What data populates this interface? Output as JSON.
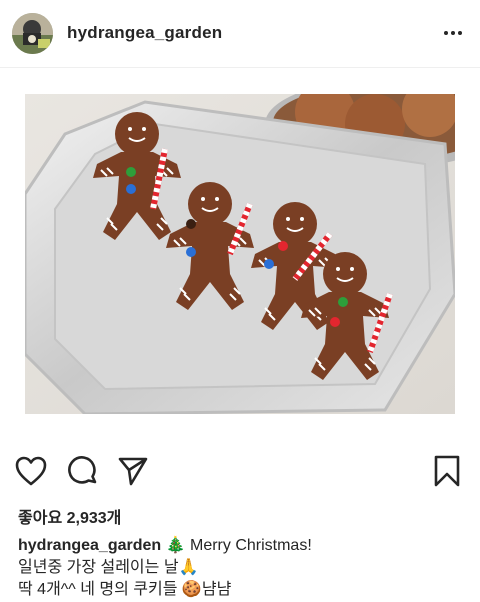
{
  "post": {
    "username": "hydrangea_garden",
    "avatar_icon": "profile-avatar",
    "more_icon": "more-options-icon",
    "image_alt": "Gingerbread man cookies on a silver tray"
  },
  "actions": {
    "like_icon": "heart-icon",
    "comment_icon": "comment-icon",
    "share_icon": "send-icon",
    "save_icon": "bookmark-icon"
  },
  "likes": {
    "text": "좋아요 2,933개"
  },
  "caption": {
    "username": "hydrangea_garden",
    "line1_emoji": "🎄",
    "line1_text": "Merry Christmas!",
    "line2_text": "일년중 가장 설레이는 날",
    "line2_emoji": "🙏",
    "line3_text": "딱 4개^^ 네 명의 쿠키들",
    "line3_emoji": "🍪",
    "line3_suffix": "냠냠"
  },
  "colors": {
    "text": "#262626",
    "divider": "#efefef",
    "cookie": "#7a3f24",
    "tray": "#cfcfcf"
  }
}
